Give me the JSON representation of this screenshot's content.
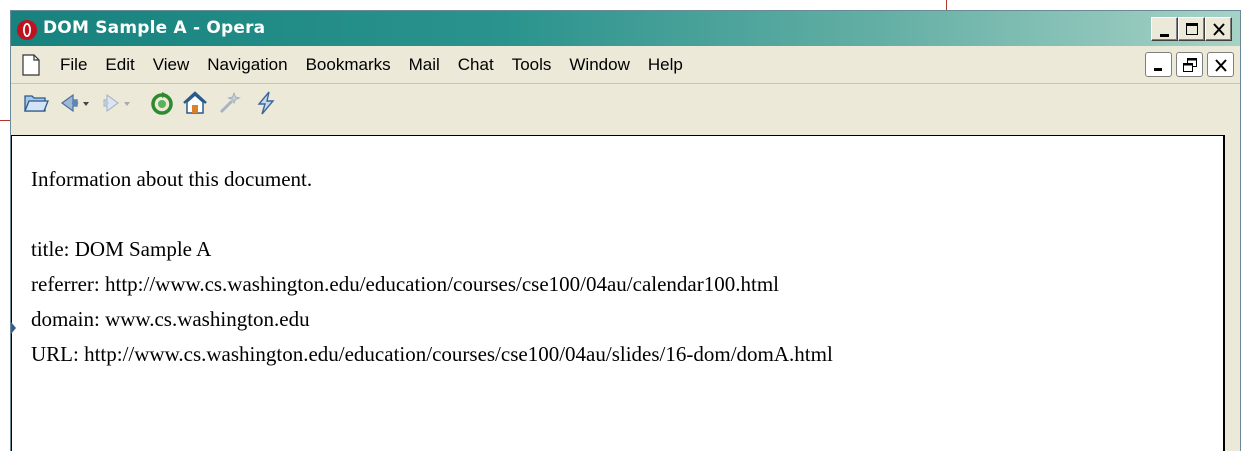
{
  "window": {
    "title": "DOM Sample A - Opera"
  },
  "menu": {
    "items": [
      "File",
      "Edit",
      "View",
      "Navigation",
      "Bookmarks",
      "Mail",
      "Chat",
      "Tools",
      "Window",
      "Help"
    ]
  },
  "toolbar": {
    "icons": [
      "open-folder-icon",
      "back-icon",
      "forward-icon",
      "reload-icon",
      "home-icon",
      "wand-icon",
      "lightning-icon"
    ]
  },
  "document": {
    "heading": "Information about this document.",
    "lines": [
      "title: DOM Sample A",
      "referrer: http://www.cs.washington.edu/education/courses/cse100/04au/calendar100.html",
      "domain: www.cs.washington.edu",
      "URL: http://www.cs.washington.edu/education/courses/cse100/04au/slides/16-dom/domA.html"
    ]
  },
  "colors": {
    "titlebar_start": "#17827e",
    "titlebar_end": "#a7d2c6",
    "chrome": "#ece9d8"
  }
}
